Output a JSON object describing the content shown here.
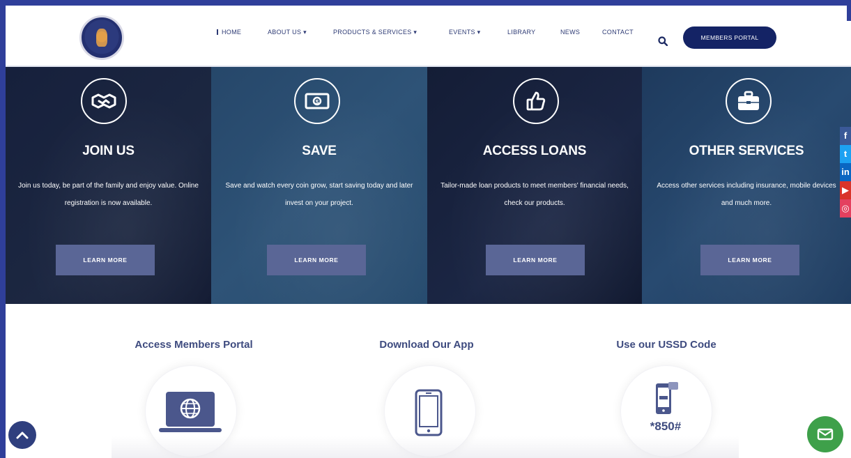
{
  "header": {
    "logo_alt": "logo",
    "nav": [
      {
        "label": "HOME",
        "active": true
      },
      {
        "label": "ABOUT US",
        "dropdown": true
      },
      {
        "label": "PRODUCTS & SERVICES",
        "dropdown": true
      },
      {
        "label": "EVENTS",
        "dropdown": true
      },
      {
        "label": "LIBRARY"
      },
      {
        "label": "NEWS"
      },
      {
        "label": "CONTACT"
      }
    ],
    "portal_button": "MEMBERS PORTAL"
  },
  "services": [
    {
      "icon": "handshake-icon",
      "title": "JOIN US",
      "description": "Join us today, be part of the family and enjoy value. Online registration is now available.",
      "button": "LEARN MORE"
    },
    {
      "icon": "money-icon",
      "title": "SAVE",
      "description": "Save and watch every coin grow, start saving today and later invest on your project.",
      "button": "LEARN MORE"
    },
    {
      "icon": "thumbs-up-icon",
      "title": "ACCESS LOANS",
      "description": "Tailor-made loan products to meet members' financial needs, check our products.",
      "button": "LEARN MORE"
    },
    {
      "icon": "briefcase-icon",
      "title": "OTHER SERVICES",
      "description": "Access other services including insurance, mobile devices and much more.",
      "button": "LEARN MORE"
    }
  ],
  "social": [
    {
      "name": "facebook-icon",
      "glyph": "f"
    },
    {
      "name": "twitter-icon",
      "glyph": "t"
    },
    {
      "name": "linkedin-icon",
      "glyph": "in"
    },
    {
      "name": "youtube-icon",
      "glyph": "▶"
    },
    {
      "name": "instagram-icon",
      "glyph": "◎"
    }
  ],
  "lower": {
    "portal_title": "Access Members Portal",
    "app_title": "Download Our App",
    "ussd_title": "Use our USSD Code",
    "ussd_code": "*850#"
  },
  "colors": {
    "accent": "#142365",
    "button": "#5a6696",
    "heading": "#3e4b7f",
    "chat": "#3ea04a"
  }
}
